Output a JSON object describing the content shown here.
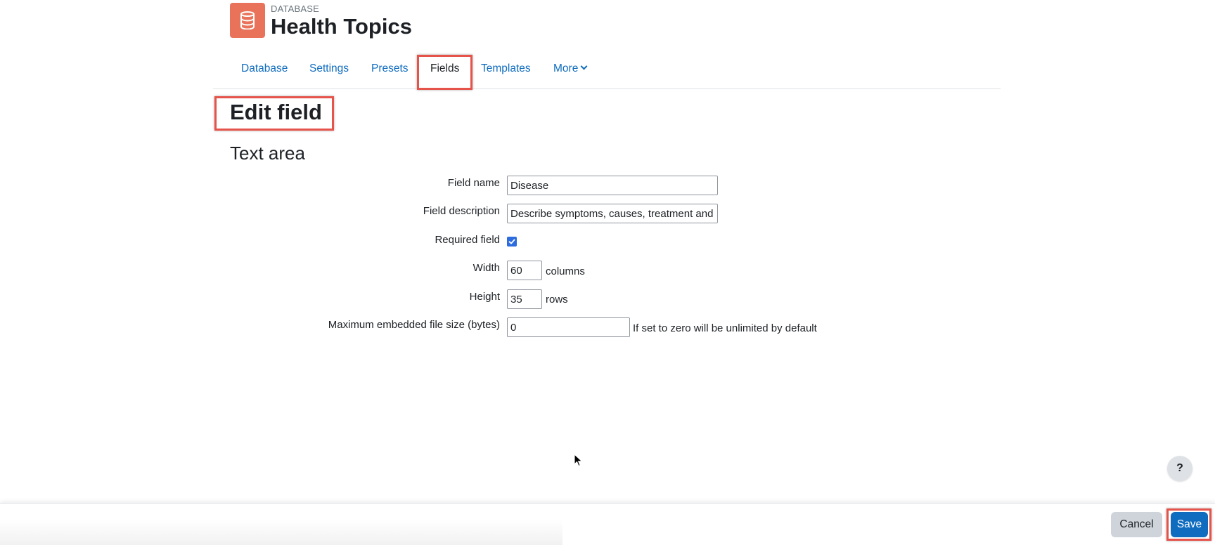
{
  "header": {
    "activity_type": "DATABASE",
    "title": "Health Topics",
    "icon": "database-icon",
    "icon_color": "#e8735a"
  },
  "tabs": [
    {
      "label": "Database"
    },
    {
      "label": "Settings"
    },
    {
      "label": "Presets"
    },
    {
      "label": "Fields",
      "active": true
    },
    {
      "label": "Templates"
    },
    {
      "label": "More"
    }
  ],
  "main": {
    "heading": "Edit field",
    "subheading": "Text area"
  },
  "form": {
    "field_name": {
      "label": "Field name",
      "value": "Disease"
    },
    "field_description": {
      "label": "Field description",
      "value": "Describe symptoms, causes, treatment and"
    },
    "required": {
      "label": "Required field",
      "checked": true
    },
    "width": {
      "label": "Width",
      "value": "60",
      "suffix": "columns"
    },
    "height": {
      "label": "Height",
      "value": "35",
      "suffix": "rows"
    },
    "max_file_size": {
      "label": "Maximum embedded file size (bytes)",
      "value": "0",
      "hint": "If set to zero will be unlimited by default"
    }
  },
  "help": {
    "label": "?"
  },
  "footer": {
    "cancel_label": "Cancel",
    "save_label": "Save"
  },
  "colors": {
    "link": "#0f6cbf",
    "highlight": "#e5534b",
    "primary_button": "#0f6cbf",
    "secondary_button": "#ced4da"
  }
}
